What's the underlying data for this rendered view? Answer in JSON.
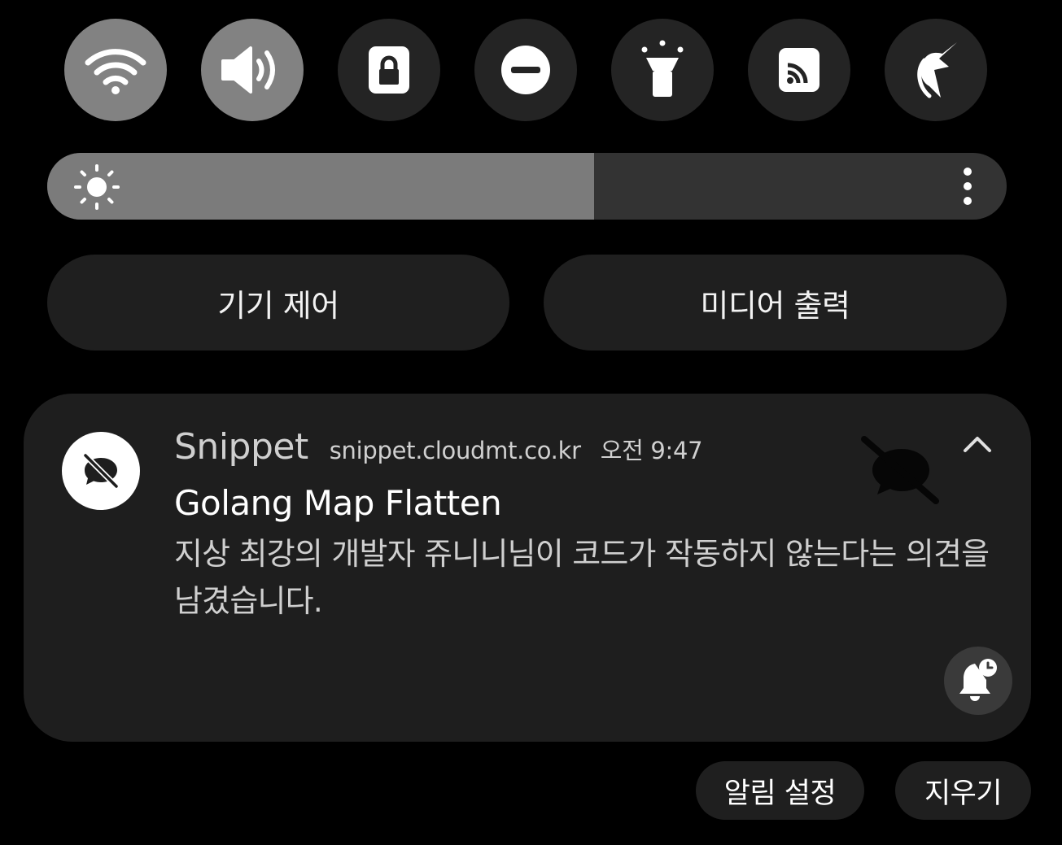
{
  "quick_settings": {
    "tiles": [
      {
        "icon": "wifi-icon",
        "active": true
      },
      {
        "icon": "sound-icon",
        "active": true
      },
      {
        "icon": "lock-icon",
        "active": false
      },
      {
        "icon": "do-not-disturb-icon",
        "active": false
      },
      {
        "icon": "flashlight-icon",
        "active": false
      },
      {
        "icon": "cast-icon",
        "active": false
      },
      {
        "icon": "unicorn-icon",
        "active": false
      }
    ]
  },
  "brightness": {
    "level_percent": 57,
    "icon": "sun-icon",
    "more_icon": "more-vertical-icon"
  },
  "panel_buttons": {
    "device_control": "기기 제어",
    "media_output": "미디어 출력"
  },
  "notification": {
    "app_icon": "chat-off-icon",
    "app_name": "Snippet",
    "domain": "snippet.cloudmt.co.kr",
    "time": "오전 9:47",
    "title": "Golang Map Flatten",
    "body": "지상 최강의 개발자 쥬니니님이 코드가 작동하지 않는다는 의견을 남겼습니다.",
    "collapse_icon": "chevron-up-icon",
    "snooze_icon": "bell-snooze-icon"
  },
  "actions": {
    "notification_settings": "알림 설정",
    "clear": "지우기"
  },
  "colors": {
    "background": "#000000",
    "active_tile": "#828282",
    "inactive_tile": "#242424",
    "card": "#1e1e1e"
  }
}
